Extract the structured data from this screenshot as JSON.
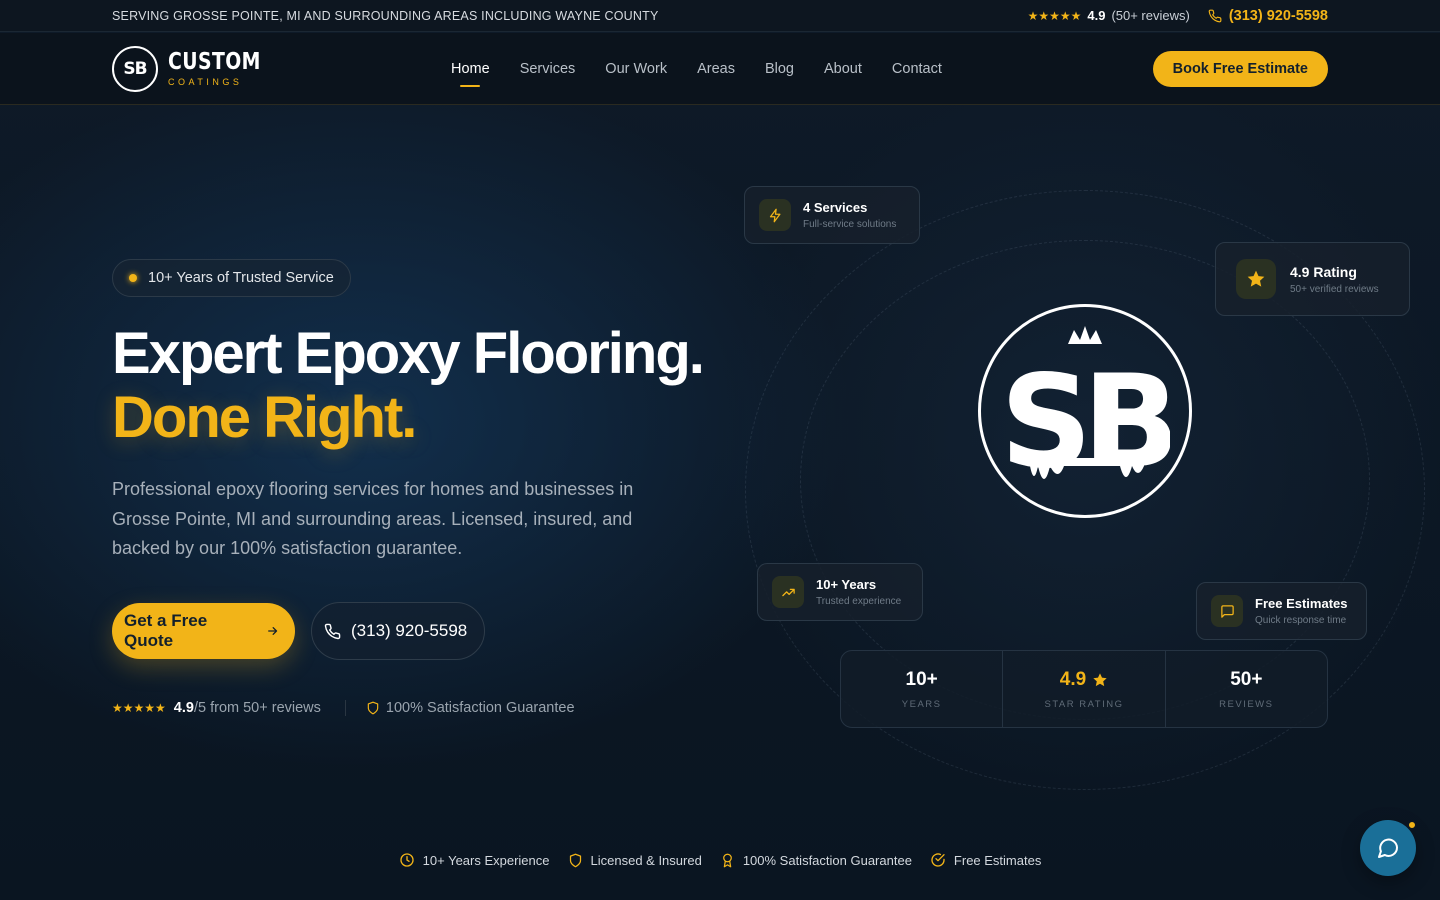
{
  "topbar": {
    "serving": "SERVING GROSSE POINTE, MI AND SURROUNDING AREAS INCLUDING WAYNE COUNTY",
    "rating_value": "4.9",
    "rating_count": "(50+ reviews)",
    "phone": "(313) 920-5598"
  },
  "nav": {
    "logo_mark": "SB",
    "brand_name": "CUSTOM",
    "brand_sub": "COATINGS",
    "links": [
      "Home",
      "Services",
      "Our Work",
      "Areas",
      "Blog",
      "About",
      "Contact"
    ],
    "active": "Home",
    "cta": "Book Free Estimate"
  },
  "hero": {
    "badge": "10+ Years of Trusted Service",
    "headline_1": "Expert Epoxy Flooring.",
    "headline_2": "Done Right.",
    "description": "Professional epoxy flooring services for homes and businesses in Grosse Pointe, MI and surrounding areas. Licensed, insured, and backed by our 100% satisfaction guarantee.",
    "cta_primary": "Get a Free Quote",
    "cta_phone": "(313) 920-5598",
    "proof_rating": "4.9",
    "proof_rest": "/5 from 50+ reviews",
    "guarantee": "100% Satisfaction Guarantee"
  },
  "cards": {
    "services": {
      "title": "4 Services",
      "sub": "Full-service solutions"
    },
    "rating": {
      "title": "4.9 Rating",
      "sub": "50+ verified reviews"
    },
    "years": {
      "title": "10+ Years",
      "sub": "Trusted experience"
    },
    "estimates": {
      "title": "Free Estimates",
      "sub": "Quick response time"
    }
  },
  "logo_big": "SB",
  "stats": [
    {
      "value": "10+",
      "label": "YEARS"
    },
    {
      "value": "4.9",
      "label": "STAR RATING"
    },
    {
      "value": "50+",
      "label": "REVIEWS"
    }
  ],
  "trust": [
    {
      "icon": "clock-icon",
      "label": "10+ Years Experience"
    },
    {
      "icon": "shield-icon",
      "label": "Licensed & Insured"
    },
    {
      "icon": "award-icon",
      "label": "100% Satisfaction Guarantee"
    },
    {
      "icon": "check-circle-icon",
      "label": "Free Estimates"
    }
  ],
  "colors": {
    "accent": "#f2b418",
    "background": "#0b1522",
    "chat": "#1a6f98"
  }
}
